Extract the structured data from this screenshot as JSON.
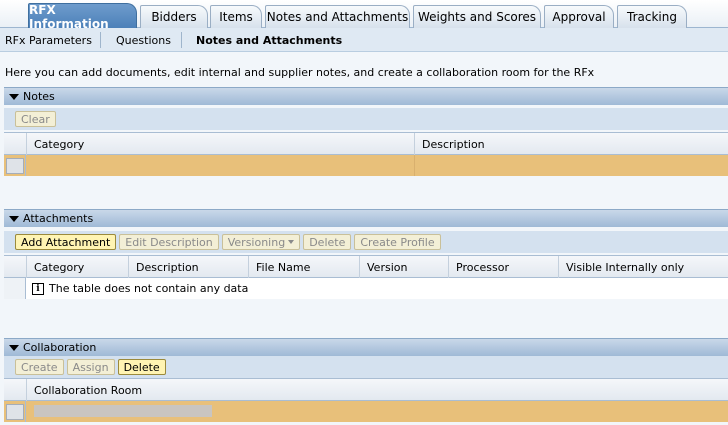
{
  "tabs": [
    "RFX Information",
    "Bidders",
    "Items",
    "Notes and Attachments",
    "Weights and Scores",
    "Approval",
    "Tracking"
  ],
  "subtabs": [
    "RFx Parameters",
    "Questions",
    "Notes and Attachments"
  ],
  "intro_text": "Here you can add documents, edit internal and supplier notes, and create a collaboration room for the RFx",
  "notes": {
    "title": "Notes",
    "buttons": {
      "clear": "Clear"
    },
    "columns": [
      "Category",
      "Description"
    ]
  },
  "attachments": {
    "title": "Attachments",
    "buttons": {
      "add": "Add Attachment",
      "edit": "Edit Description",
      "versioning": "Versioning",
      "delete": "Delete",
      "create_profile": "Create Profile"
    },
    "columns": [
      "Category",
      "Description",
      "File Name",
      "Version",
      "Processor",
      "Visible Internally only"
    ],
    "empty_text": "The table does not contain any data"
  },
  "collaboration": {
    "title": "Collaboration",
    "buttons": {
      "create": "Create",
      "assign": "Assign",
      "delete": "Delete"
    },
    "columns": [
      "Collaboration Room"
    ]
  }
}
